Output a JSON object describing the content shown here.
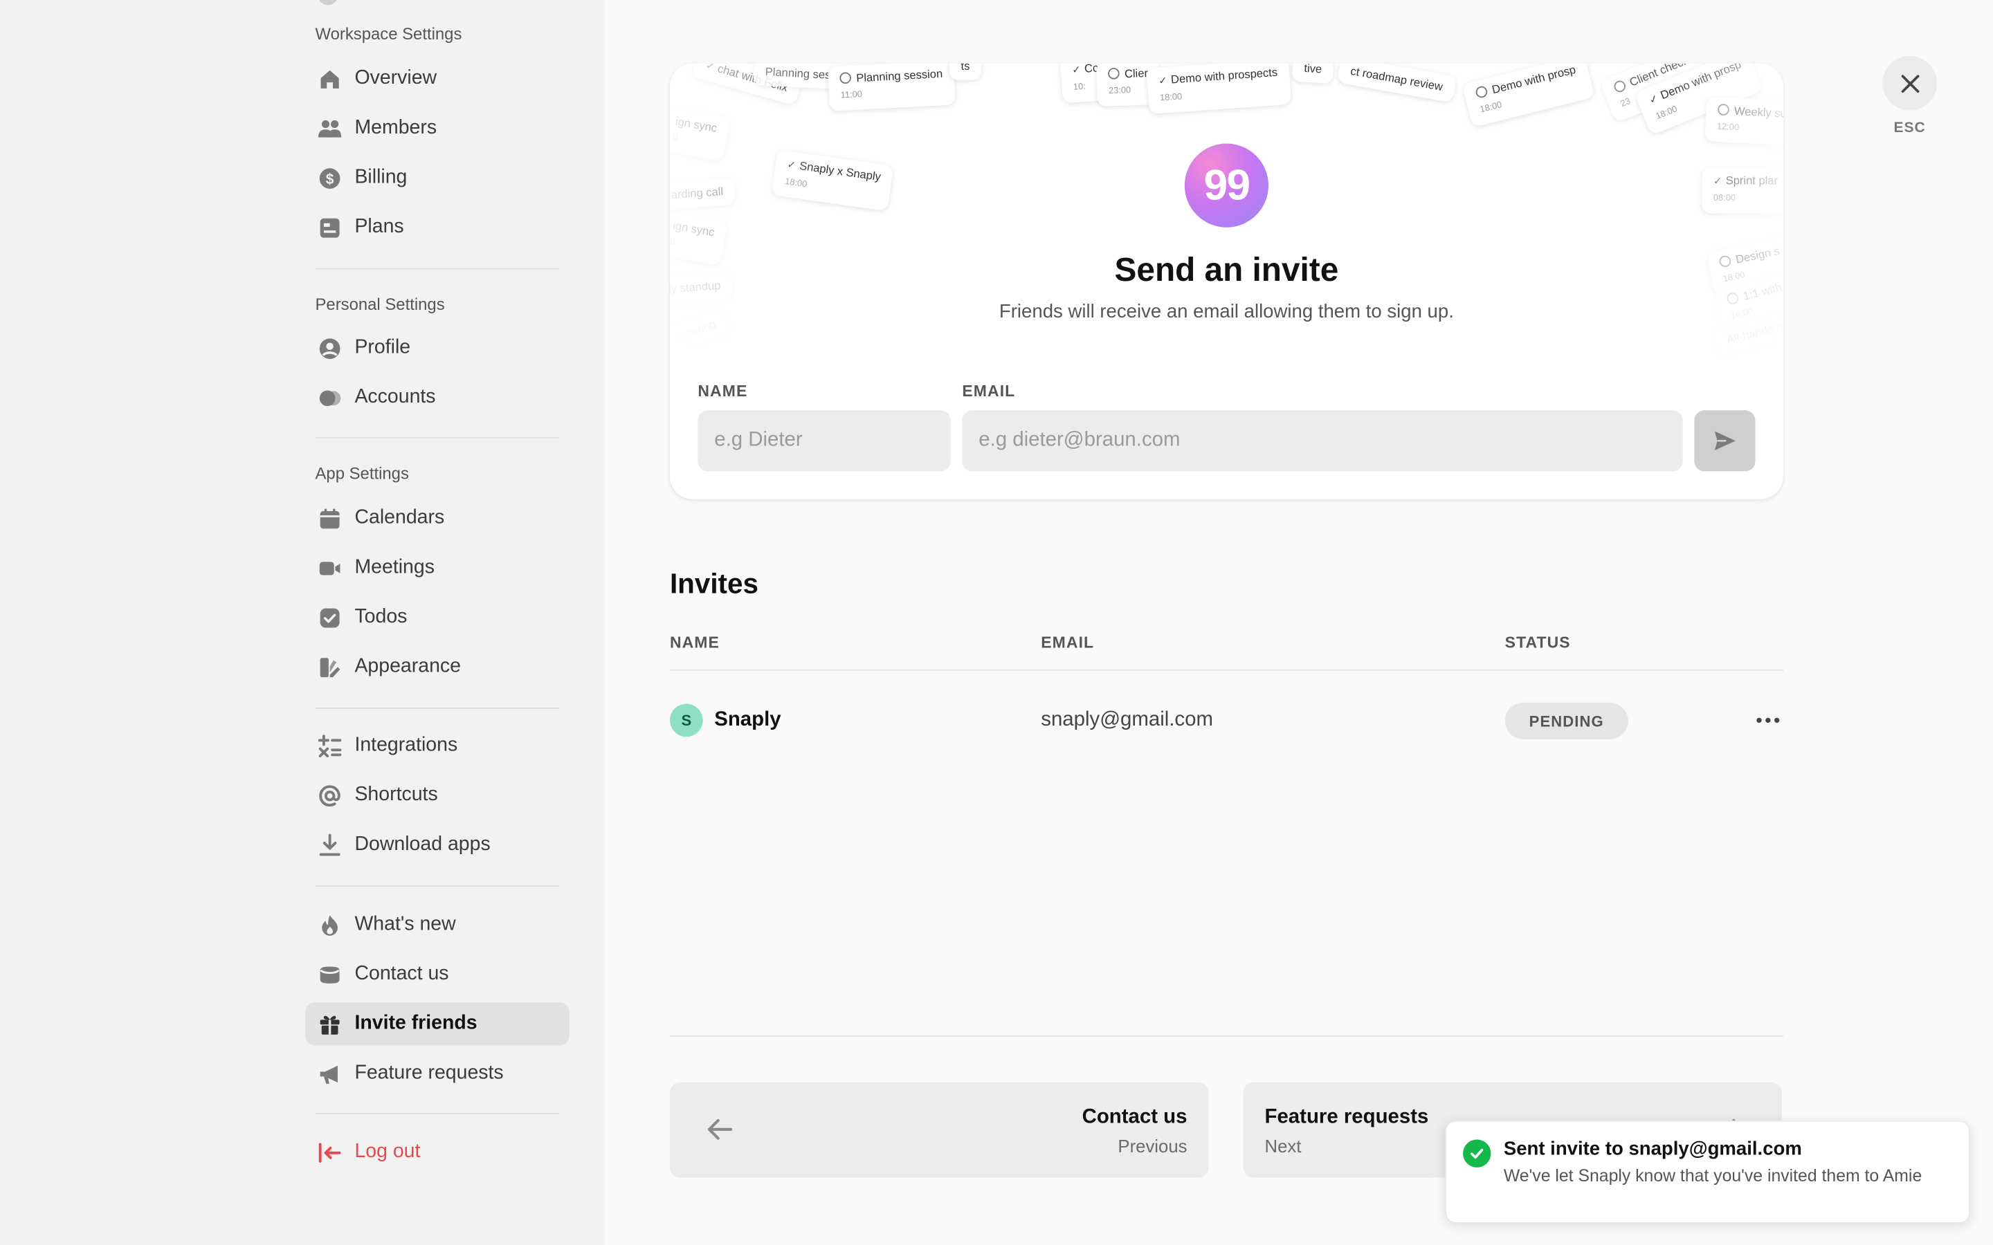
{
  "sidebar": {
    "sections": [
      {
        "heading": "Workspace Settings",
        "items": [
          {
            "label": "Overview",
            "icon": "home-icon"
          },
          {
            "label": "Members",
            "icon": "members-icon"
          },
          {
            "label": "Billing",
            "icon": "dollar-icon"
          },
          {
            "label": "Plans",
            "icon": "plans-icon"
          }
        ]
      },
      {
        "heading": "Personal Settings",
        "items": [
          {
            "label": "Profile",
            "icon": "profile-icon"
          },
          {
            "label": "Accounts",
            "icon": "accounts-icon"
          }
        ]
      },
      {
        "heading": "App Settings",
        "items": [
          {
            "label": "Calendars",
            "icon": "calendar-icon"
          },
          {
            "label": "Meetings",
            "icon": "video-icon"
          },
          {
            "label": "Todos",
            "icon": "checkbox-icon"
          },
          {
            "label": "Appearance",
            "icon": "appearance-icon"
          }
        ]
      },
      {
        "heading": "",
        "items": [
          {
            "label": "Integrations",
            "icon": "integrations-icon"
          },
          {
            "label": "Shortcuts",
            "icon": "at-icon"
          },
          {
            "label": "Download apps",
            "icon": "download-icon"
          }
        ]
      },
      {
        "heading": "",
        "items": [
          {
            "label": "What's new",
            "icon": "flame-icon"
          },
          {
            "label": "Contact us",
            "icon": "inbox-icon"
          },
          {
            "label": "Invite friends",
            "icon": "gift-icon",
            "active": true
          },
          {
            "label": "Feature requests",
            "icon": "megaphone-icon"
          }
        ]
      }
    ],
    "logout": {
      "label": "Log out",
      "icon": "logout-icon",
      "color": "#e5484d"
    }
  },
  "invite_card": {
    "badge": "99",
    "title": "Send an invite",
    "subtitle": "Friends will receive an email allowing them to sign up.",
    "name_label": "NAME",
    "email_label": "EMAIL",
    "name_placeholder": "e.g Dieter",
    "email_placeholder": "e.g dieter@braun.com",
    "send_icon": "send-icon",
    "background_events": [
      {
        "title": "chat with Felix",
        "time": ""
      },
      {
        "title": "Planning session",
        "time": "11:00"
      },
      {
        "title": "Planning sessio",
        "time": ""
      },
      {
        "title": "ts",
        "time": ""
      },
      {
        "title": "Cc",
        "time": "10:"
      },
      {
        "title": "Clier",
        "time": "23:00"
      },
      {
        "title": "Demo with prospects",
        "time": "18:00"
      },
      {
        "title": "tive",
        "time": ""
      },
      {
        "title": "ct roadmap review",
        "time": ""
      },
      {
        "title": "Demo with prosp",
        "time": "18:00"
      },
      {
        "title": "Client check",
        "time": "23"
      },
      {
        "title": "Demo with prosp",
        "time": "18:00"
      },
      {
        "title": "Weekly su",
        "time": "12:00"
      },
      {
        "title": "ign sync",
        "time": "0"
      },
      {
        "title": "Snaply x Snaply",
        "time": "18:00"
      },
      {
        "title": "arding call",
        "time": ""
      },
      {
        "title": "ign sync",
        "time": "0"
      },
      {
        "title": "Sprint plar",
        "time": "08:00"
      },
      {
        "title": "ly standup",
        "time": ""
      },
      {
        "title": "Design s",
        "time": "18:00"
      },
      {
        "title": "1:1 with A",
        "time": "16:00"
      },
      {
        "title": "All-hands m",
        "time": ""
      },
      {
        "title": "meeting",
        "time": ""
      }
    ]
  },
  "close": {
    "label": "ESC",
    "icon": "close-icon"
  },
  "invites": {
    "title": "Invites",
    "columns": [
      "NAME",
      "EMAIL",
      "STATUS"
    ],
    "rows": [
      {
        "initial": "S",
        "name": "Snaply",
        "email": "snaply@gmail.com",
        "status": "PENDING"
      }
    ]
  },
  "footer_nav": {
    "prev": {
      "title": "Contact us",
      "sub": "Previous",
      "icon": "arrow-left-icon"
    },
    "next": {
      "title": "Feature requests",
      "sub": "Next",
      "icon": "arrow-right-icon"
    }
  },
  "toast": {
    "title": "Sent invite to snaply@gmail.com",
    "body": "We've let Snaply know that you've invited them to Amie",
    "icon": "check-circle-icon"
  },
  "colors": {
    "accent_red": "#e5484d",
    "success_green": "#14b84b",
    "avatar_mint": "#8fe0c3"
  }
}
